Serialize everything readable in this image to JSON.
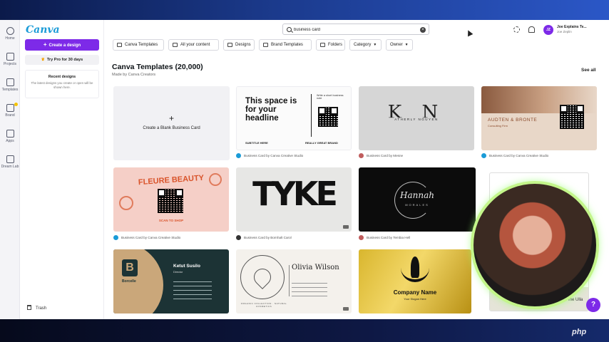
{
  "app": {
    "logo": "Canva"
  },
  "rail": [
    {
      "name": "home",
      "label": "Home"
    },
    {
      "name": "projects",
      "label": "Projects"
    },
    {
      "name": "templates",
      "label": "Templates"
    },
    {
      "name": "brand",
      "label": "Brand"
    },
    {
      "name": "apps",
      "label": "Apps"
    },
    {
      "name": "dreamlab",
      "label": "Dream Lab"
    }
  ],
  "panel": {
    "create_label": "Create a design",
    "pro_label": "Try Pro for 30 days",
    "recent_title": "Recent designs",
    "recent_desc": "The latest designs you create or open will be shown here.",
    "trash_label": "Trash"
  },
  "search": {
    "value": "business card",
    "placeholder": "Search"
  },
  "account": {
    "initials": "JZ",
    "name": "Joe Explains Te...",
    "sub": "Joe Zeplin"
  },
  "filters": [
    {
      "label": "Canva Templates"
    },
    {
      "label": "All your content"
    },
    {
      "label": "Designs"
    },
    {
      "label": "Brand Templates"
    },
    {
      "label": "Folders"
    },
    {
      "label": "Category"
    },
    {
      "label": "Owner"
    }
  ],
  "section": {
    "title": "Canva Templates (20,000)",
    "sub": "Made by Canva Creators",
    "see_all": "See all"
  },
  "cards": [
    {
      "caption": "",
      "blank_label": "Create a Blank Business Card",
      "blank_plus": "+"
    },
    {
      "caption": "Business Card by Canva Creative Studio",
      "headline": "This space is for your headline",
      "side_text": "Write a short business note",
      "foot_left": "SUBTITLE HERE",
      "foot_right": "REALLY GREAT BRAND"
    },
    {
      "caption": "Business Card by Mesne",
      "mono": "K N",
      "mono_sub": "ATHERLY NGUYEN"
    },
    {
      "caption": "Business Card by Canva Creative Studio",
      "brand": "AUDTEN & BRONTE",
      "brand_sub": "Consulting Firm"
    },
    {
      "caption": "Business Card by Canva Creative Studio",
      "title": "FLEURE BEAUTY",
      "sub": "SCAN TO SHOP"
    },
    {
      "caption": "Business Card by Bornhalt Carol",
      "word": "TYKE"
    },
    {
      "caption": "Business Card by Tembia Hell",
      "script": "Hannah",
      "script_sub": "MORALES"
    },
    {
      "caption": "",
      "partial": "",
      "partial2": "Ine Ulla"
    },
    {
      "caption": "",
      "name": "Ketut Susilo",
      "role": "Director",
      "logo_letter": "B",
      "logo_text": "Borcelle"
    },
    {
      "caption": "",
      "name": "Olivia Wilson",
      "ring": "ORGANIC COLLECTION · NATURAL COSMETICS"
    },
    {
      "caption": "",
      "company": "Company Name",
      "slogan": "Your Slogan Here"
    }
  ],
  "help": "?",
  "watermark": "php"
}
